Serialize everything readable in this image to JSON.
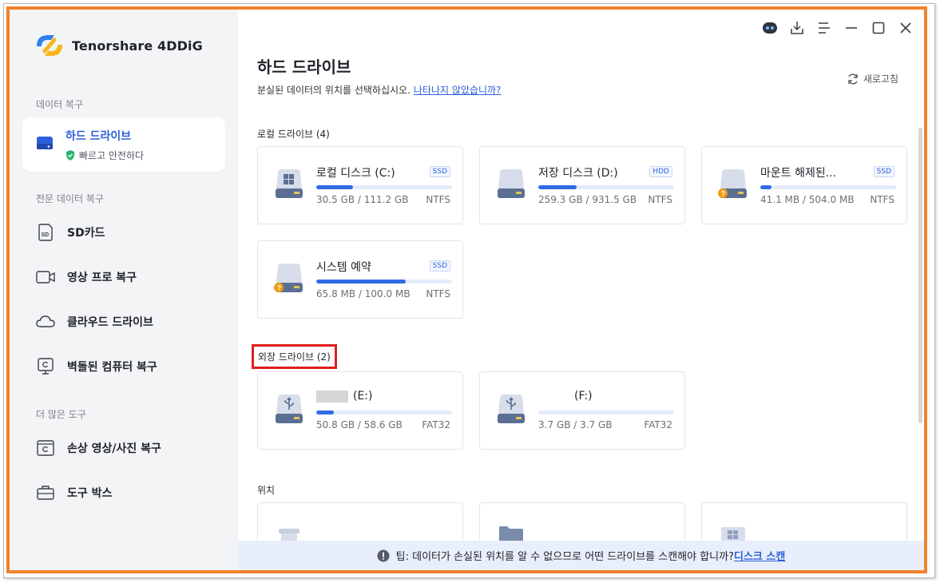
{
  "app": {
    "name": "Tenorshare 4DDiG",
    "brand_color": "#2b5fd9",
    "frame_color": "#f0822c"
  },
  "sidebar": {
    "sections": [
      {
        "label": "데이터 복구"
      },
      {
        "label": "전문 데이터 복구"
      },
      {
        "label": "더 많은 도구"
      }
    ],
    "active_item": {
      "label": "하드 드라이브",
      "sub_label": "빠르고 안전하다",
      "icon": "hard-drive-icon"
    },
    "items": [
      {
        "label": "SD카드",
        "icon": "sd-card-icon"
      },
      {
        "label": "영상 프로 복구",
        "icon": "video-camera-icon"
      },
      {
        "label": "클라우드 드라이브",
        "icon": "cloud-icon"
      },
      {
        "label": "벽돌된 컴퓨터 복구",
        "icon": "computer-repair-icon"
      },
      {
        "label": "손상 영상/사진 복구",
        "icon": "photo-repair-icon"
      },
      {
        "label": "도구 박스",
        "icon": "toolbox-icon"
      }
    ]
  },
  "header": {
    "title": "하드 드라이브",
    "subtitle": "분실된 데이터의 위치를 선택하십시오.",
    "help_link": "나타나지 않았습니까?",
    "refresh_label": "새로고침"
  },
  "local_drives": {
    "label": "로컬 드라이브 (4)",
    "items": [
      {
        "name": "로컬 디스크 (C:)",
        "type": "SSD",
        "size": "30.5 GB / 111.2 GB",
        "fs": "NTFS",
        "used": 0.27,
        "icon": "windows-drive-icon"
      },
      {
        "name": "저장 디스크 (D:)",
        "type": "HDD",
        "size": "259.3 GB / 931.5 GB",
        "fs": "NTFS",
        "used": 0.28,
        "icon": "drive-icon"
      },
      {
        "name": "마운트 해제된...",
        "type": "SSD",
        "size": "41.1 MB / 504.0 MB",
        "fs": "NTFS",
        "used": 0.08,
        "icon": "unknown-drive-icon"
      },
      {
        "name": "시스템 예약",
        "type": "SSD",
        "size": "65.8 MB / 100.0 MB",
        "fs": "NTFS",
        "used": 0.66,
        "icon": "unknown-drive-icon"
      }
    ]
  },
  "external_drives": {
    "label": "외장 드라이브 (2)",
    "items": [
      {
        "name": "(E:)",
        "size": "50.8 GB / 58.6 GB",
        "fs": "FAT32",
        "used": 0.13,
        "icon": "usb-drive-icon"
      },
      {
        "name": "(F:)",
        "size": "3.7 GB / 3.7 GB",
        "fs": "FAT32",
        "used": 0.0,
        "icon": "usb-drive-icon"
      }
    ]
  },
  "locations": {
    "label": "위치"
  },
  "tip": {
    "text": "팁: 데이터가 손실된 위치를 알 수 없으므로 어떤 드라이브를 스캔해야 합니까?",
    "link": "디스크 스캔"
  }
}
